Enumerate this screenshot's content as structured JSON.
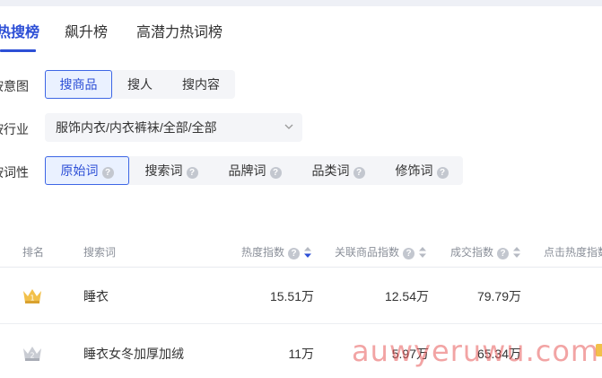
{
  "tabs": [
    {
      "label": "热搜榜",
      "active": true
    },
    {
      "label": "飙升榜",
      "active": false
    },
    {
      "label": "高潜力热词榜",
      "active": false
    }
  ],
  "intent": {
    "label": "按意图",
    "options": [
      "搜商品",
      "搜人",
      "搜内容"
    ],
    "selected": "搜商品"
  },
  "industry": {
    "label": "按行业",
    "value": "服饰内衣/内衣裤袜/全部/全部"
  },
  "wordtype": {
    "label": "按词性",
    "options": [
      "原始词",
      "搜索词",
      "品牌词",
      "品类词",
      "修饰词"
    ],
    "selected": "原始词"
  },
  "table": {
    "columns": [
      "排名",
      "搜索词",
      "热度指数",
      "关联商品指数",
      "成交指数",
      "点击热度指数"
    ],
    "sort_column": "热度指数",
    "rows": [
      {
        "rank": "1",
        "keyword": "睡衣",
        "heat": "15.51万",
        "related": "12.54万",
        "deal": "79.79万"
      },
      {
        "rank": "2",
        "keyword": "睡衣女冬加厚加绒",
        "heat": "11万",
        "related": "5.97万",
        "deal": "65.34万"
      }
    ]
  },
  "watermark": "auwyeruwu.com",
  "colors": {
    "accent": "#2d4fd6",
    "active_bg": "#eaf1ff",
    "segment_bg": "#f4f5f8",
    "header_text": "#8a8f99",
    "gold_medal": "#f2c04a",
    "silver_medal": "#c9ccd3"
  },
  "icons": {
    "help": "question-circle-icon",
    "sort": "sort-caret-icon",
    "chevron": "chevron-down-icon",
    "medal_gold": "crown-medal-gold-icon",
    "medal_silver": "crown-medal-silver-icon"
  }
}
